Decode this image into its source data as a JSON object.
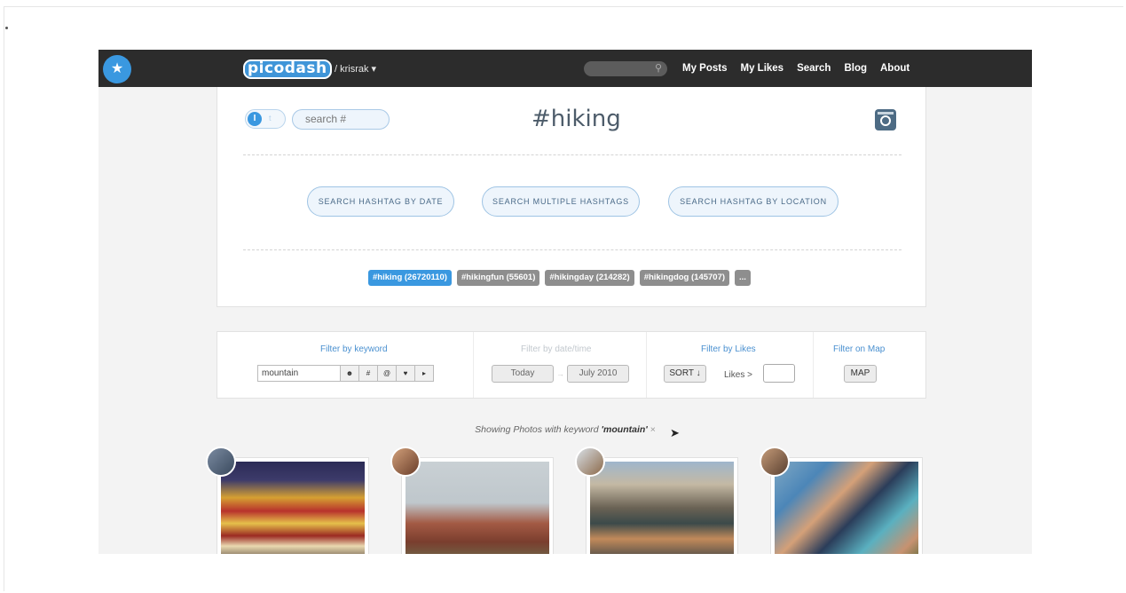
{
  "header": {
    "logo": "picodash",
    "user": "/ krisrak ▾",
    "search_icon": "search-icon",
    "star_icon": "star-icon",
    "nav": [
      "My Posts",
      "My Likes",
      "Search",
      "Blog",
      "About"
    ]
  },
  "hero": {
    "toggle_on": "I",
    "toggle_off": "t",
    "search_placeholder": "search #",
    "title": "#hiking",
    "actions": [
      "SEARCH HASHTAG BY DATE",
      "SEARCH MULTIPLE HASHTAGS",
      "SEARCH HASHTAG BY LOCATION"
    ],
    "related_tags": [
      {
        "label": "#hiking (26720110)",
        "active": true
      },
      {
        "label": "#hikingfun (55601)",
        "active": false
      },
      {
        "label": "#hikingday (214282)",
        "active": false
      },
      {
        "label": "#hikingdog (145707)",
        "active": false
      },
      {
        "label": "...",
        "active": false
      }
    ]
  },
  "filters": {
    "keyword": {
      "title": "Filter by keyword",
      "value": "mountain",
      "buttons": [
        "☻",
        "#",
        "@",
        "♥",
        "▸"
      ]
    },
    "date": {
      "title": "Filter by date/time",
      "from": "Today",
      "arrow": "→",
      "to": "July 2010"
    },
    "likes": {
      "title": "Filter by Likes",
      "sort": "SORT ↓",
      "likes_label": "Likes  >"
    },
    "map": {
      "title": "Filter on Map",
      "button": "MAP"
    }
  },
  "results": {
    "prefix": "Showing Photos with keyword ",
    "keyword": "'mountain'",
    "clear": "×"
  },
  "colors": {
    "accent": "#3a98e0",
    "topbar": "#2c2c2c",
    "tag_inactive": "#8e8e8e"
  }
}
